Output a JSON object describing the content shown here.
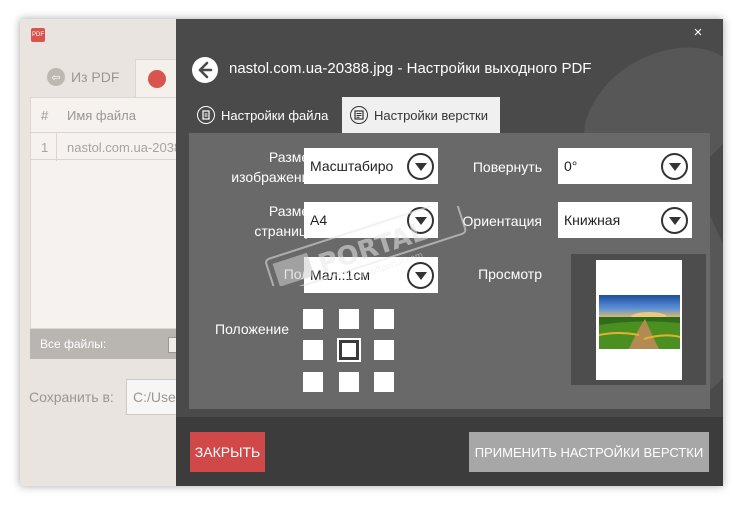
{
  "background": {
    "app_icon_text": "PDF",
    "tab_from_pdf": "Из PDF",
    "table": {
      "col_num": "#",
      "col_name": "Имя файла",
      "rows": [
        {
          "num": "1",
          "name": "nastol.com.ua-2038"
        }
      ]
    },
    "footer_label": "Все файлы:",
    "save_label": "Сохранить в:",
    "save_value": "C:/Use"
  },
  "modal": {
    "close_glyph": "×",
    "title": "nastol.com.ua-20388.jpg - Настройки выходного PDF",
    "tabs": [
      {
        "label": "Настройки файла"
      },
      {
        "label": "Настройки верстки"
      }
    ],
    "fields": {
      "image_size": {
        "label_line1": "Размер",
        "label_line2": "изображения",
        "value": "Масштабиро"
      },
      "page_size": {
        "label_line1": "Размер",
        "label_line2": "страницы",
        "value": "A4"
      },
      "margins": {
        "label": "Поля",
        "value": "Мал.:1см"
      },
      "rotate": {
        "label": "Повернуть",
        "value": "0°"
      },
      "orientation": {
        "label": "Ориентация",
        "value": "Книжная"
      },
      "preview": {
        "label": "Просмотр"
      },
      "position": {
        "label": "Положение",
        "selected_cell": 4
      }
    },
    "buttons": {
      "close": "ЗАКРЫТЬ",
      "apply": "ПРИМЕНИТЬ НАСТРОЙКИ ВЕРСТКИ"
    }
  },
  "watermark": {
    "text": "PORTAL",
    "subtext": "www.softportal.com"
  },
  "colors": {
    "modal_bg": "#4a4a4a",
    "panel_bg": "#696969",
    "close_button": "#d04848",
    "apply_button": "#a7a7a7",
    "bg_window": "#e9e4df"
  },
  "icons": [
    "app-icon",
    "from-pdf-icon",
    "close-icon",
    "back-arrow-icon",
    "file-settings-icon",
    "layout-settings-icon",
    "dropdown-chevron-icon"
  ]
}
